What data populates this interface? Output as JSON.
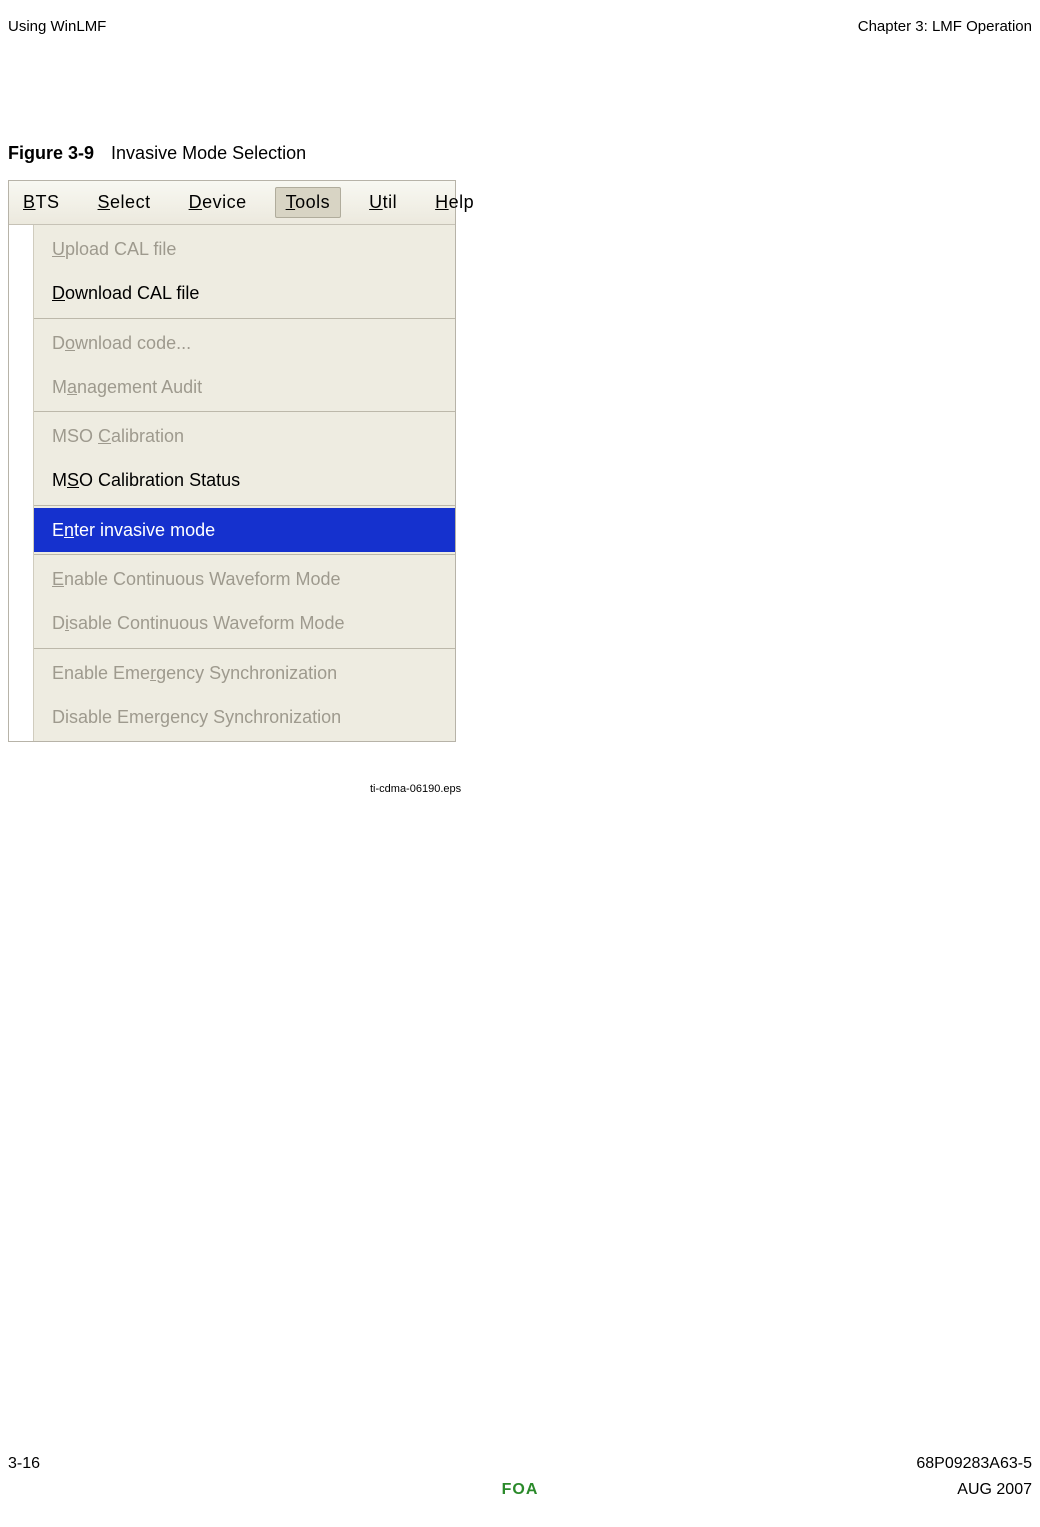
{
  "header": {
    "left": "Using WinLMF",
    "right": "Chapter 3: LMF Operation"
  },
  "figure": {
    "number": "Figure 3-9",
    "title": "Invasive Mode Selection"
  },
  "menubar": [
    {
      "label_pre": "",
      "mnemonic": "B",
      "label_post": "TS",
      "active": false
    },
    {
      "label_pre": "",
      "mnemonic": "S",
      "label_post": "elect",
      "active": false
    },
    {
      "label_pre": "",
      "mnemonic": "D",
      "label_post": "evice",
      "active": false
    },
    {
      "label_pre": "",
      "mnemonic": "T",
      "label_post": "ools",
      "active": true
    },
    {
      "label_pre": "",
      "mnemonic": "U",
      "label_post": "til",
      "active": false
    },
    {
      "label_pre": "",
      "mnemonic": "H",
      "label_post": "elp",
      "active": false
    }
  ],
  "dropdown": [
    {
      "items": [
        {
          "label_pre": "",
          "mnemonic": "U",
          "label_post": "pload CAL file",
          "state": "disabled"
        },
        {
          "label_pre": "",
          "mnemonic": "D",
          "label_post": "ownload CAL file",
          "state": "enabled"
        }
      ]
    },
    {
      "items": [
        {
          "label_pre": "D",
          "mnemonic": "o",
          "label_post": "wnload code...",
          "state": "disabled"
        },
        {
          "label_pre": "M",
          "mnemonic": "a",
          "label_post": "nagement Audit",
          "state": "disabled"
        }
      ]
    },
    {
      "items": [
        {
          "label_pre": "MSO ",
          "mnemonic": "C",
          "label_post": "alibration",
          "state": "disabled"
        },
        {
          "label_pre": "M",
          "mnemonic": "S",
          "label_post": "O Calibration Status",
          "state": "enabled"
        }
      ]
    },
    {
      "items": [
        {
          "label_pre": "E",
          "mnemonic": "n",
          "label_post": "ter invasive mode",
          "state": "highlight"
        }
      ]
    },
    {
      "items": [
        {
          "label_pre": "",
          "mnemonic": "E",
          "label_post": "nable Continuous Waveform Mode",
          "state": "disabled"
        },
        {
          "label_pre": "D",
          "mnemonic": "i",
          "label_post": "sable Continuous Waveform Mode",
          "state": "disabled"
        }
      ]
    },
    {
      "items": [
        {
          "label_pre": "Enable Eme",
          "mnemonic": "r",
          "label_post": "gency Synchronization",
          "state": "disabled"
        },
        {
          "label_pre": "Disable Emer",
          "mnemonic": "g",
          "label_post": "ency Synchronization",
          "state": "disabled"
        }
      ]
    }
  ],
  "image_ref": "ti-cdma-06190.eps",
  "footer": {
    "page": "3-16",
    "docid": "68P09283A63-5",
    "foa": "FOA",
    "date": "AUG 2007"
  }
}
